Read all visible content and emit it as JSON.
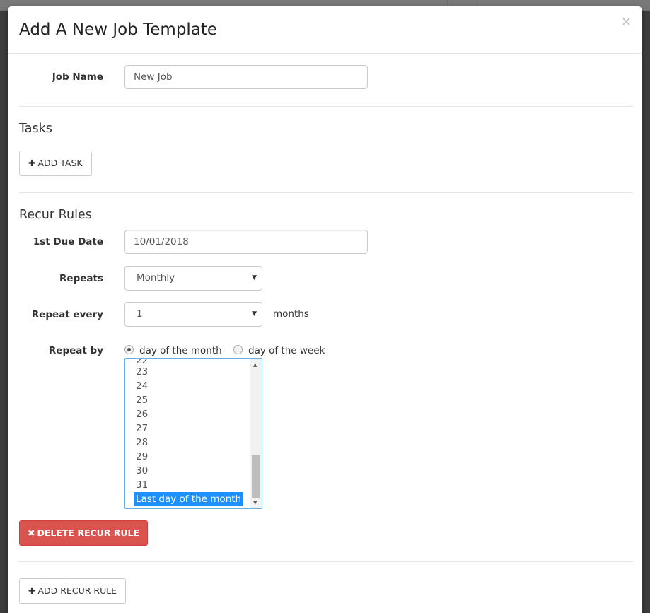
{
  "modal": {
    "title": "Add A New Job Template",
    "close_glyph": "×"
  },
  "job_name": {
    "label": "Job Name",
    "value": "New Job"
  },
  "tasks": {
    "section_title": "Tasks",
    "add_task_label": "ADD TASK"
  },
  "recur_rules": {
    "section_title": "Recur Rules",
    "due_date_label": "1st Due Date",
    "due_date_value": "10/01/2018",
    "repeats_label": "Repeats",
    "repeats_value": "Monthly",
    "repeat_every_label": "Repeat every",
    "repeat_every_value": "1",
    "repeat_every_unit": "months",
    "repeat_by_label": "Repeat by",
    "repeat_by_options": [
      {
        "label": "day of the month",
        "checked": true
      },
      {
        "label": "day of the week",
        "checked": false
      }
    ],
    "day_list": {
      "partial_top": "22",
      "options": [
        "23",
        "24",
        "25",
        "26",
        "27",
        "28",
        "29",
        "30",
        "31"
      ],
      "selected": "Last day of the month"
    },
    "delete_label": "DELETE RECUR RULE",
    "add_label": "ADD RECUR RULE"
  },
  "icons": {
    "plus": "plus-icon",
    "remove": "remove-icon",
    "caret": "caret-down-icon"
  },
  "colors": {
    "danger": "#d9534f",
    "selection": "#1e90ff",
    "focus_border": "#66afe9"
  }
}
